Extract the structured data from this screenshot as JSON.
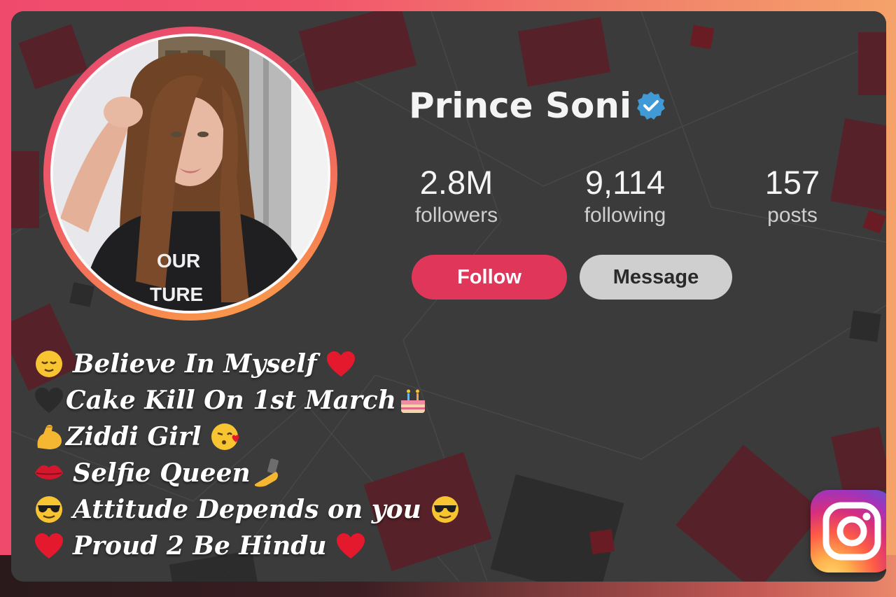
{
  "profile": {
    "name": "Prince Soni",
    "verified": true,
    "stats": {
      "followers": {
        "value": "2.8M",
        "label": "followers"
      },
      "following": {
        "value": "9,114",
        "label": "following"
      },
      "posts": {
        "value": "157",
        "label": "posts"
      }
    },
    "actions": {
      "follow": "Follow",
      "message": "Message"
    }
  },
  "bio": [
    {
      "lead_icon": "relieved-face-emoji",
      "text": "Believe In Myself",
      "trail_icon": "red-heart-emoji"
    },
    {
      "lead_icon": "black-heart-emoji",
      "text": "Cake Kill On 1st March",
      "trail_icon": "birthday-cake-emoji"
    },
    {
      "lead_icon": "flexed-biceps-emoji",
      "text": "Ziddi Girl",
      "trail_icon": "kissing-face-emoji"
    },
    {
      "lead_icon": "kiss-lips-emoji",
      "text": "Selfie Queen",
      "trail_icon": "selfie-emoji"
    },
    {
      "lead_icon": "sunglasses-face-emoji",
      "text": "Attitude Depends on you",
      "trail_icon": "sunglasses-face-emoji"
    },
    {
      "lead_icon": "red-heart-emoji",
      "text": "Proud 2 Be Hindu",
      "trail_icon": "red-heart-emoji"
    }
  ],
  "colors": {
    "accent": "#e0365a",
    "message_button": "#cfcfcf",
    "verified_badge": "#3f9ad6",
    "card_background": "#3a3a3a"
  },
  "icons": {
    "verified": "verified-badge-icon",
    "brand": "instagram-logo-icon"
  }
}
